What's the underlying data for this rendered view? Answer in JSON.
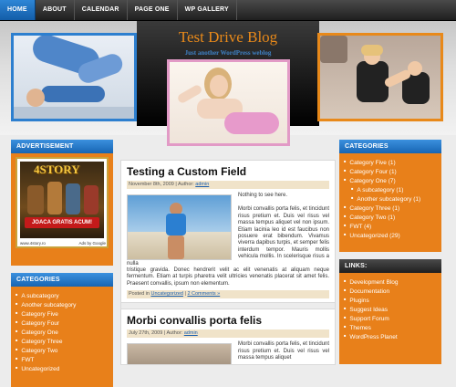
{
  "nav": {
    "items": [
      "HOME",
      "ABOUT",
      "CALENDAR",
      "PAGE ONE",
      "WP GALLERY"
    ],
    "active_index": 0
  },
  "header": {
    "title": "Test Drive Blog",
    "tagline": "Just another WordPress weblog",
    "accent_color": "#e8891a",
    "blue_color": "#2d7fcf",
    "pink_color": "#e29ac6"
  },
  "left_sidebar": {
    "advertisement": {
      "title": "ADVERTISEMENT",
      "logo_text": "4STORY",
      "cta": "JOACA GRATIS ACUM!",
      "site": "www.4story.ro",
      "ads_by": "Ads by Google"
    },
    "categories": {
      "title": "CATEGORIES",
      "items": [
        {
          "label": "A subcategory",
          "sub": false
        },
        {
          "label": "Another subcategory",
          "sub": false
        },
        {
          "label": "Category Five",
          "sub": false
        },
        {
          "label": "Category Four",
          "sub": false
        },
        {
          "label": "Category One",
          "sub": false
        },
        {
          "label": "Category Three",
          "sub": false
        },
        {
          "label": "Category Two",
          "sub": false
        },
        {
          "label": "FWT",
          "sub": false
        },
        {
          "label": "Uncategorized",
          "sub": false
        }
      ]
    }
  },
  "right_sidebar": {
    "categories": {
      "title": "CATEGORIES",
      "items": [
        {
          "label": "Category Five (1)",
          "sub": false
        },
        {
          "label": "Category Four (1)",
          "sub": false
        },
        {
          "label": "Category One (7)",
          "sub": false
        },
        {
          "label": "A subcategory (1)",
          "sub": true
        },
        {
          "label": "Another subcategory (1)",
          "sub": true
        },
        {
          "label": "Category Three (1)",
          "sub": false
        },
        {
          "label": "Category Two (1)",
          "sub": false
        },
        {
          "label": "FWT (4)",
          "sub": false
        },
        {
          "label": "Uncategorized (29)",
          "sub": false
        }
      ]
    },
    "links": {
      "title": "LINKS:",
      "items": [
        {
          "label": "Development Blog",
          "sub": false
        },
        {
          "label": "Documentation",
          "sub": false
        },
        {
          "label": "Plugins",
          "sub": false
        },
        {
          "label": "Suggest Ideas",
          "sub": false
        },
        {
          "label": "Support Forum",
          "sub": false
        },
        {
          "label": "Themes",
          "sub": false
        },
        {
          "label": "WordPress Planet",
          "sub": false
        }
      ]
    }
  },
  "posts": [
    {
      "title": "Testing a Custom Field",
      "date": "November 8th, 2009 | Author: ",
      "author": "admin",
      "lead": "Nothing to see here.",
      "body_side": "Morbi convallis porta felis, et tincidunt risus pretium et. Duis vel risus vel massa tempus aliquet vel non ipsum. Etiam lacinia leo id est faucibus non posuere erat bibendum. Vivamus viverra dapibus turpis, et semper felis interdum tempor. Mauris mollis vehicula mollis. In scelerisque risus a nulla",
      "body_rest": "tristique gravida. Donec hendrerit velit ac elit venenatis at aliquam neque fermentum. Etiam at turpis pharetra velit ultricies venenatis placerat sit amet felis. Praesent convallis, ipsum non elementum.",
      "footer_prefix": "Posted in ",
      "footer_category": "Uncategorized",
      "footer_sep": " | ",
      "footer_comments": "2 Comments »"
    },
    {
      "title": "Morbi convallis porta felis",
      "date": "July 27th, 2009 | Author: ",
      "author": "admin",
      "body_side": "Morbi convallis porta felis, et tincidunt risus pretium et. Duis vel risus vel massa tempus aliquet"
    }
  ]
}
